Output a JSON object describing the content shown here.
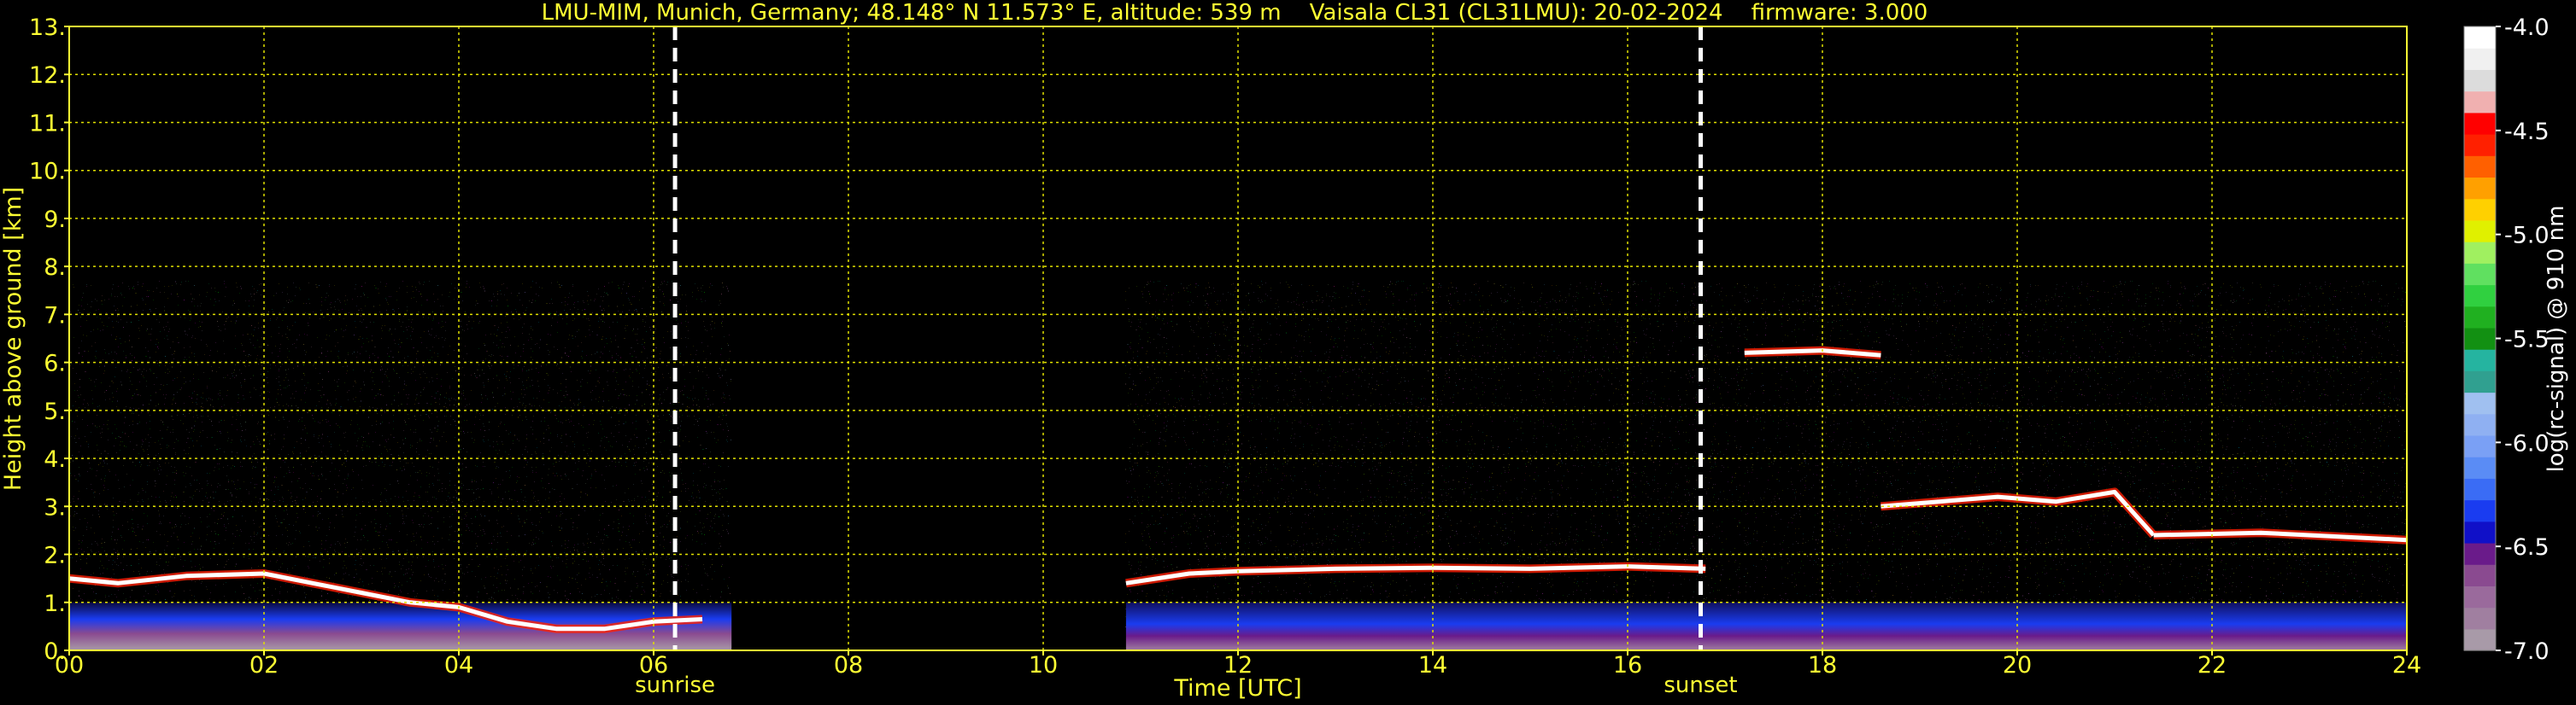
{
  "chart_data": {
    "type": "heatmap",
    "title": {
      "site": "LMU-MIM, Munich, Germany; 48.148° N 11.573° E, altitude: 539 m",
      "instrument": "Vaisala CL31 (CL31LMU): 20-02-2024",
      "firmware": "firmware: 3.000"
    },
    "xlabel": "Time [UTC]",
    "ylabel": "Height above ground [km]",
    "xlim": [
      0,
      24
    ],
    "ylim": [
      0,
      13
    ],
    "x_ticks": [
      "00",
      "02",
      "04",
      "06",
      "08",
      "10",
      "12",
      "14",
      "16",
      "18",
      "20",
      "22",
      "24"
    ],
    "y_ticks": [
      "0.",
      "1.",
      "2.",
      "3.",
      "4.",
      "5.",
      "6.",
      "7.",
      "8.",
      "9.",
      "10.",
      "11.",
      "12.",
      "13."
    ],
    "grid": true,
    "grid_color": "#e0e000",
    "events": [
      {
        "label": "sunrise",
        "time": 6.22
      },
      {
        "label": "sunset",
        "time": 16.75
      }
    ],
    "data_periods": [
      [
        0,
        6.8
      ],
      [
        10.85,
        24
      ]
    ],
    "max_range_km": 7.7,
    "colorbar": {
      "label": "log(rc-signal) @ 910 nm",
      "range": [
        -7.0,
        -4.0
      ],
      "ticks": [
        "-4.0",
        "-4.5",
        "-5.0",
        "-5.5",
        "-6.0",
        "-6.5",
        "-7.0"
      ],
      "colors": [
        "#a89aa8",
        "#a07fa0",
        "#9a6a9c",
        "#8a4a90",
        "#6a1b8a",
        "#1010c8",
        "#1a3cf0",
        "#3a6cf5",
        "#5a8cf5",
        "#7aa0f5",
        "#8fb0f2",
        "#a0c0f0",
        "#30a090",
        "#25b4a0",
        "#129012",
        "#20b020",
        "#30d040",
        "#60e060",
        "#a0f060",
        "#e0f000",
        "#ffd000",
        "#ffa000",
        "#ff6000",
        "#ff2000",
        "#ff0000",
        "#f0b0b0",
        "#dcdcdc",
        "#f0f0f0",
        "#ffffff"
      ]
    },
    "layers": [
      {
        "name": "aerosol-layer",
        "t_start": 0,
        "t_end": 6.8,
        "top_km": 1.0
      },
      {
        "name": "aerosol-layer",
        "t_start": 10.85,
        "t_end": 24,
        "top_km": 1.0
      },
      {
        "name": "boundary-layer-top",
        "points": [
          [
            0,
            1.5
          ],
          [
            0.5,
            1.4
          ],
          [
            1.2,
            1.55
          ],
          [
            2,
            1.6
          ],
          [
            2.5,
            1.4
          ],
          [
            3,
            1.2
          ],
          [
            3.5,
            1.0
          ],
          [
            4,
            0.9
          ],
          [
            4.5,
            0.6
          ],
          [
            5,
            0.45
          ],
          [
            5.5,
            0.45
          ],
          [
            6,
            0.6
          ],
          [
            6.5,
            0.65
          ]
        ]
      },
      {
        "name": "boundary-layer-top",
        "points": [
          [
            10.85,
            1.4
          ],
          [
            11.5,
            1.6
          ],
          [
            12,
            1.65
          ],
          [
            13,
            1.7
          ],
          [
            14,
            1.72
          ],
          [
            15,
            1.7
          ],
          [
            16,
            1.75
          ],
          [
            16.8,
            1.7
          ]
        ]
      },
      {
        "name": "cloud-layer",
        "points": [
          [
            17.2,
            6.2
          ],
          [
            18.0,
            6.25
          ],
          [
            18.6,
            6.15
          ]
        ]
      },
      {
        "name": "cloud-layer",
        "points": [
          [
            18.6,
            3.0
          ],
          [
            19.2,
            3.1
          ],
          [
            19.8,
            3.2
          ],
          [
            20.4,
            3.1
          ],
          [
            21.0,
            3.3
          ],
          [
            21.4,
            2.4
          ]
        ]
      },
      {
        "name": "cloud-layer",
        "points": [
          [
            21.4,
            2.4
          ],
          [
            22.5,
            2.45
          ],
          [
            24,
            2.3
          ]
        ]
      }
    ]
  }
}
